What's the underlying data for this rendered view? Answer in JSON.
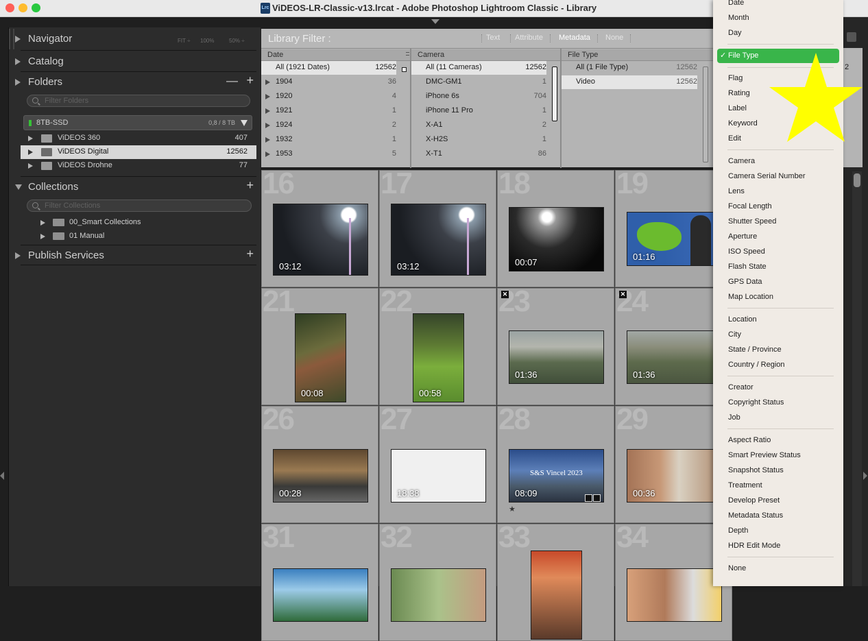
{
  "window": {
    "title": "ViDEOS-LR-Classic-v13.lrcat - Adobe Photoshop Lightroom Classic - Library",
    "app_icon_text": "Lrc"
  },
  "left_panel": {
    "navigator": {
      "label": "Navigator",
      "zoom_options": [
        "FIT ÷",
        "100%",
        "50% ÷"
      ]
    },
    "catalog": {
      "label": "Catalog"
    },
    "folders": {
      "label": "Folders",
      "filter_placeholder": "Filter Folders",
      "drive": {
        "name": "8TB-SSD",
        "size": "0,8 / 8 TB"
      },
      "items": [
        {
          "name": "ViDEOS 360",
          "count": "407"
        },
        {
          "name": "ViDEOS Digital",
          "count": "12562"
        },
        {
          "name": "ViDEOS Drohne",
          "count": "77"
        }
      ]
    },
    "collections": {
      "label": "Collections",
      "filter_placeholder": "Filter Collections",
      "items": [
        {
          "name": "00_Smart Collections"
        },
        {
          "name": "01 Manual"
        }
      ]
    },
    "publish": {
      "label": "Publish Services"
    }
  },
  "library_filter": {
    "title": "Library Filter :",
    "tabs": [
      "Text",
      "Attribute",
      "Metadata",
      "None"
    ],
    "active_tab": "Metadata"
  },
  "metadata_columns": {
    "date": {
      "header": "Date",
      "rows": [
        {
          "label": "All (1921 Dates)",
          "count": "12562"
        },
        {
          "label": "1904",
          "count": "36"
        },
        {
          "label": "1920",
          "count": "4"
        },
        {
          "label": "1921",
          "count": "1"
        },
        {
          "label": "1924",
          "count": "2"
        },
        {
          "label": "1932",
          "count": "1"
        },
        {
          "label": "1953",
          "count": "5"
        }
      ]
    },
    "camera": {
      "header": "Camera",
      "rows": [
        {
          "label": "All (11 Cameras)",
          "count": "12562"
        },
        {
          "label": "DMC-GM1",
          "count": "1"
        },
        {
          "label": "iPhone 6s",
          "count": "704"
        },
        {
          "label": "iPhone 11 Pro",
          "count": "1"
        },
        {
          "label": "X-A1",
          "count": "2"
        },
        {
          "label": "X-H2S",
          "count": "1"
        },
        {
          "label": "X-T1",
          "count": "86"
        }
      ]
    },
    "file_type": {
      "header": "File Type",
      "rows": [
        {
          "label": "All (1 File Type)",
          "count": "12562"
        },
        {
          "label": "Video",
          "count": "12562"
        }
      ]
    },
    "fourth_col_count": "2"
  },
  "grid": {
    "cells": [
      {
        "num": "16",
        "duration": "03:12"
      },
      {
        "num": "17",
        "duration": "03:12"
      },
      {
        "num": "18",
        "duration": "00:07"
      },
      {
        "num": "19",
        "duration": "01:16"
      },
      {
        "num": "21",
        "duration": "00:08"
      },
      {
        "num": "22",
        "duration": "00:58"
      },
      {
        "num": "23",
        "duration": "01:36"
      },
      {
        "num": "24",
        "duration": "01:36"
      },
      {
        "num": "26",
        "duration": "00:28"
      },
      {
        "num": "27",
        "duration": "18:38"
      },
      {
        "num": "28",
        "duration": "08:09",
        "overlay_text": "S&S Vincel 2023"
      },
      {
        "num": "29",
        "duration": "00:36"
      },
      {
        "num": "31",
        "duration": ""
      },
      {
        "num": "32",
        "duration": ""
      },
      {
        "num": "33",
        "duration": ""
      },
      {
        "num": "34",
        "duration": ""
      }
    ],
    "rating_star": "★",
    "flag_glyph": "✕"
  },
  "dropdown_menu": {
    "top_items": [
      "Date",
      "Month",
      "Day"
    ],
    "selected": {
      "check": "✓",
      "label": "File Type"
    },
    "groups": [
      [
        "Flag",
        "Rating",
        "Label",
        "Keyword",
        "Edit"
      ],
      [
        "Camera",
        "Camera Serial Number",
        "Lens",
        "Focal Length",
        "Shutter Speed",
        "Aperture",
        "ISO Speed",
        "Flash State",
        "GPS Data",
        "Map Location"
      ],
      [
        "Location",
        "City",
        "State / Province",
        "Country / Region"
      ],
      [
        "Creator",
        "Copyright Status",
        "Job"
      ],
      [
        "Aspect Ratio",
        "Smart Preview Status",
        "Snapshot Status",
        "Treatment",
        "Develop Preset",
        "Metadata Status",
        "Depth",
        "HDR Edit Mode"
      ],
      [
        "None"
      ]
    ]
  },
  "colors": {
    "menu_selected": "#39b54a",
    "annotation_star": "#ffff00",
    "drive_led": "#36c236"
  }
}
